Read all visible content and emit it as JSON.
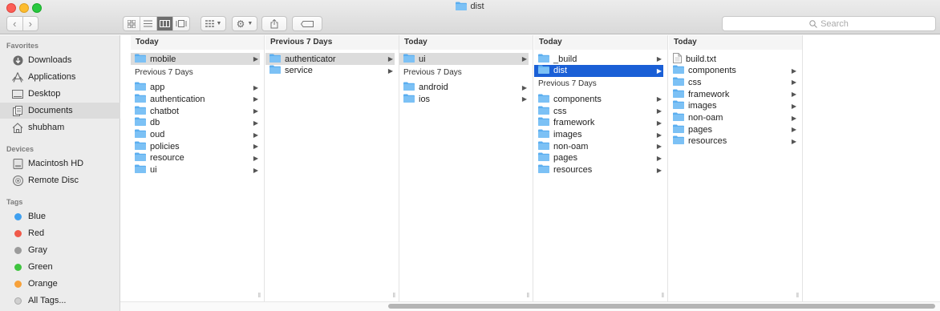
{
  "window": {
    "title": "dist"
  },
  "search": {
    "placeholder": "Search"
  },
  "sidebar": {
    "favorites_heading": "Favorites",
    "favorites": [
      {
        "label": "Downloads",
        "icon": "downloads-icon"
      },
      {
        "label": "Applications",
        "icon": "applications-icon"
      },
      {
        "label": "Desktop",
        "icon": "desktop-icon"
      },
      {
        "label": "Documents",
        "icon": "documents-icon",
        "active": true
      },
      {
        "label": "shubham",
        "icon": "home-icon"
      }
    ],
    "devices_heading": "Devices",
    "devices": [
      {
        "label": "Macintosh HD",
        "icon": "harddisk-icon"
      },
      {
        "label": "Remote Disc",
        "icon": "disc-icon"
      }
    ],
    "tags_heading": "Tags",
    "tags": [
      {
        "label": "Blue",
        "color": "#3fa0f0"
      },
      {
        "label": "Red",
        "color": "#f05a4a"
      },
      {
        "label": "Gray",
        "color": "#9b9b9b"
      },
      {
        "label": "Green",
        "color": "#3fc43f"
      },
      {
        "label": "Orange",
        "color": "#f7a13a"
      },
      {
        "label": "All Tags...",
        "color": "#d0d0d0"
      }
    ]
  },
  "columns": [
    {
      "header": "Today",
      "today": [
        {
          "label": "mobile",
          "arrow": true,
          "sel": "gray"
        }
      ],
      "group2_label": "Previous 7 Days",
      "previous": [
        {
          "label": "app",
          "arrow": true
        },
        {
          "label": "authentication",
          "arrow": true
        },
        {
          "label": "chatbot",
          "arrow": true
        },
        {
          "label": "db",
          "arrow": true
        },
        {
          "label": "oud",
          "arrow": true
        },
        {
          "label": "policies",
          "arrow": true
        },
        {
          "label": "resource",
          "arrow": true
        },
        {
          "label": "ui",
          "arrow": true
        }
      ]
    },
    {
      "header": "Previous 7 Days",
      "today": [
        {
          "label": "authenticator",
          "arrow": true,
          "sel": "gray"
        },
        {
          "label": "service",
          "arrow": true
        }
      ],
      "group2_label": "",
      "previous": []
    },
    {
      "header": "Today",
      "today": [
        {
          "label": "ui",
          "arrow": true,
          "sel": "gray"
        }
      ],
      "group2_label": "Previous 7 Days",
      "previous": [
        {
          "label": "android",
          "arrow": true
        },
        {
          "label": "ios",
          "arrow": true
        }
      ]
    },
    {
      "header": "Today",
      "today": [
        {
          "label": "_build",
          "arrow": true
        },
        {
          "label": "dist",
          "arrow": true,
          "sel": "blue"
        }
      ],
      "group2_label": "Previous 7 Days",
      "previous": [
        {
          "label": "components",
          "arrow": true
        },
        {
          "label": "css",
          "arrow": true
        },
        {
          "label": "framework",
          "arrow": true
        },
        {
          "label": "images",
          "arrow": true
        },
        {
          "label": "non-oam",
          "arrow": true
        },
        {
          "label": "pages",
          "arrow": true
        },
        {
          "label": "resources",
          "arrow": true
        }
      ]
    },
    {
      "header": "Today",
      "today": [
        {
          "label": "build.txt",
          "arrow": false,
          "file": true
        },
        {
          "label": "components",
          "arrow": true
        },
        {
          "label": "css",
          "arrow": true
        },
        {
          "label": "framework",
          "arrow": true
        },
        {
          "label": "images",
          "arrow": true
        },
        {
          "label": "non-oam",
          "arrow": true
        },
        {
          "label": "pages",
          "arrow": true
        },
        {
          "label": "resources",
          "arrow": true
        }
      ],
      "group2_label": "",
      "previous": []
    }
  ]
}
